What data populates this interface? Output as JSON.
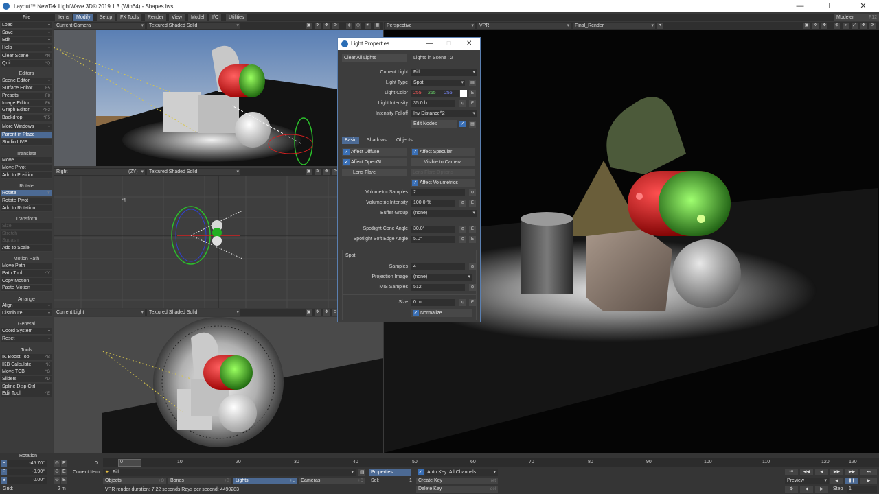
{
  "window": {
    "title": "Layout™ NewTek LightWave 3D® 2019.1.3 (Win64) - Shapes.lws"
  },
  "top_menu": {
    "file_label": "File",
    "tabs": [
      "Items",
      "Modify",
      "Setup",
      "FX Tools",
      "Render",
      "View",
      "Model",
      "I/O",
      "Utilities"
    ],
    "active_tab": "Modify",
    "modeler_label": "Modeler",
    "modeler_shortcut": "F12"
  },
  "left_toolbar": {
    "file_items": [
      {
        "label": "Load"
      },
      {
        "label": "Save"
      },
      {
        "label": "Edit"
      },
      {
        "label": "Help"
      },
      {
        "label": "Clear Scene",
        "shortcut": "^N"
      },
      {
        "label": "Quit",
        "shortcut": "^Q"
      }
    ],
    "editors_header": "Editors",
    "editors": [
      {
        "label": "Scene Editor",
        "shortcut": "^F1"
      },
      {
        "label": "Surface Editor",
        "shortcut": "F5"
      },
      {
        "label": "Presets",
        "shortcut": "F8"
      },
      {
        "label": "Image Editor",
        "shortcut": "F6"
      },
      {
        "label": "Graph Editor",
        "shortcut": "^F2"
      },
      {
        "label": "Backdrop",
        "shortcut": "^F5"
      },
      {
        "label": "More Windows"
      },
      {
        "label": "Parent in Place"
      },
      {
        "label": "Studio LIVE"
      }
    ],
    "translate_header": "Translate",
    "translate": [
      {
        "label": "Move"
      },
      {
        "label": "Move Pivot"
      },
      {
        "label": "Add to Position"
      }
    ],
    "rotate_header": "Rotate",
    "rotate": [
      {
        "label": "Rotate",
        "shortcut": "Y"
      },
      {
        "label": "Rotate Pivot"
      },
      {
        "label": "Add to Rotation"
      }
    ],
    "transform_header": "Transform",
    "transform": [
      {
        "label": "Size"
      },
      {
        "label": "Stretch"
      },
      {
        "label": "Squash"
      },
      {
        "label": "Add to Scale"
      }
    ],
    "motion_header": "Motion Path",
    "motion": [
      {
        "label": "Move Path"
      },
      {
        "label": "Path Tool",
        "shortcut": "^Y"
      },
      {
        "label": "Copy Motion"
      },
      {
        "label": "Paste Motion"
      }
    ],
    "arrange_header": "Arrange",
    "arrange": [
      {
        "label": "Align"
      },
      {
        "label": "Distribute"
      }
    ],
    "general_header": "General",
    "general": [
      {
        "label": "Coord System"
      },
      {
        "label": "Reset"
      }
    ],
    "tools_header": "Tools",
    "tools": [
      {
        "label": "IK Boost Tool",
        "shortcut": "^B"
      },
      {
        "label": "IKB Calculate",
        "shortcut": "^K"
      },
      {
        "label": "Move TCB",
        "shortcut": "^G"
      },
      {
        "label": "Sliders",
        "shortcut": "^D"
      },
      {
        "label": "Spline Disp Ctrl"
      },
      {
        "label": "Edit Tool",
        "shortcut": "^E"
      }
    ]
  },
  "viewports": {
    "top_left": {
      "view": "Current Camera",
      "shading": "Textured Shaded Solid"
    },
    "mid_left": {
      "view": "Right",
      "axis": "(ZY)",
      "shading": "Textured Shaded Solid"
    },
    "bottom_left": {
      "view": "Current Light",
      "shading": "Textured Shaded Solid"
    },
    "right": {
      "view": "Perspective",
      "mode": "VPR",
      "camera": "Final_Render"
    }
  },
  "dialog": {
    "title": "Light Properties",
    "clear_all": "Clear All Lights",
    "lights_in_scene": "Lights in Scene : 2",
    "current_light_label": "Current Light",
    "current_light": "Fill",
    "light_type_label": "Light Type",
    "light_type": "Spot",
    "light_color_label": "Light Color",
    "color_r": "255",
    "color_g": "255",
    "color_b": "255",
    "intensity_label": "Light Intensity",
    "intensity": "35.0 lx",
    "falloff_label": "Intensity Falloff",
    "falloff": "Inv Distance^2",
    "edit_nodes": "Edit Nodes",
    "tabs": [
      "Basic",
      "Shadows",
      "Objects"
    ],
    "affect_diffuse": "Affect Diffuse",
    "affect_specular": "Affect Specular",
    "affect_opengl": "Affect OpenGL",
    "visible_camera": "Visible to Camera",
    "lens_flare": "Lens Flare",
    "lens_flare_options": "Lens Flare Options",
    "affect_volumetrics": "Affect Volumetrics",
    "vol_samples_label": "Volumetric Samples",
    "vol_samples": "2",
    "vol_intensity_label": "Volumetric Intensity",
    "vol_intensity": "100.0 %",
    "buffer_group_label": "Buffer Group",
    "buffer_group": "(none)",
    "cone_angle_label": "Spotlight Cone Angle",
    "cone_angle": "30.0°",
    "soft_edge_label": "Spotlight Soft Edge Angle",
    "soft_edge": "5.0°",
    "spot_section": "Spot",
    "samples_label": "Samples",
    "samples": "4",
    "projection_label": "Projection Image",
    "projection": "(none)",
    "mis_label": "MIS Samples",
    "mis": "512",
    "size_label": "Size",
    "size": "0 m",
    "normalize": "Normalize"
  },
  "bottom": {
    "rotation_label": "Rotation",
    "h_label": "H",
    "h_value": "-45.70°",
    "p_label": "P",
    "p_value": "-0.90°",
    "b_label": "B",
    "b_value": "0.00°",
    "grid_label": "Grid:",
    "grid_value": "2 m",
    "frame_start": "0",
    "ticks": [
      "0",
      "10",
      "20",
      "30",
      "40",
      "50",
      "60",
      "70",
      "80",
      "90",
      "100",
      "110",
      "120"
    ],
    "frame_end": "120",
    "current_item_label": "Current Item",
    "current_item": "Fill",
    "objects": "Objects",
    "bones": "Bones",
    "lights": "Lights",
    "cameras": "Cameras",
    "properties": "Properties",
    "sel_label": "Sel:",
    "sel_value": "1",
    "auto_key": "Auto Key: All Channels",
    "create_key": "Create Key",
    "delete_key": "Delete Key",
    "preview": "Preview",
    "step_label": "Step",
    "step_value": "1",
    "status": "VPR render duration: 7.22 seconds  Rays per second: 4490283"
  }
}
